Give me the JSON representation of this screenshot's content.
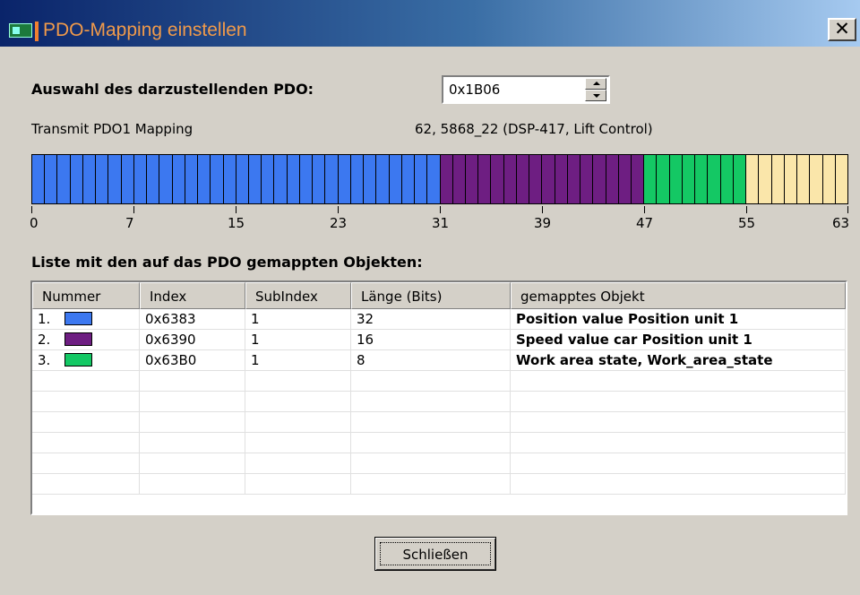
{
  "window": {
    "title": "PDO-Mapping einstellen",
    "close_glyph": "✕"
  },
  "selector": {
    "label": "Auswahl des darzustellenden PDO:",
    "value": "0x1B06"
  },
  "pdo_info": {
    "left": "Transmit PDO1 Mapping",
    "right": "62, 5868_22 (DSP-417, Lift Control)"
  },
  "bitbar": {
    "total_bits": 64,
    "segments": [
      {
        "color": "#3c78f0",
        "bits": 32
      },
      {
        "color": "#6e1e82",
        "bits": 16
      },
      {
        "color": "#14c864",
        "bits": 8
      },
      {
        "color": "#fae6aa",
        "bits": 8
      }
    ],
    "ticks": [
      "0",
      "7",
      "15",
      "23",
      "31",
      "39",
      "47",
      "55",
      "63"
    ]
  },
  "list": {
    "heading": "Liste mit den auf das PDO gemappten Objekten:",
    "columns": [
      "Nummer",
      "Index",
      "SubIndex",
      "Länge (Bits)",
      "gemapptes Objekt"
    ],
    "rows": [
      {
        "nummer": "1.",
        "color": "#3c78f0",
        "index": "0x6383",
        "subindex": "1",
        "laenge": "32",
        "objekt": "Position value Position unit 1"
      },
      {
        "nummer": "2.",
        "color": "#6e1e82",
        "index": "0x6390",
        "subindex": "1",
        "laenge": "16",
        "objekt": "Speed value car Position unit 1"
      },
      {
        "nummer": "3.",
        "color": "#14c864",
        "index": "0x63B0",
        "subindex": "1",
        "laenge": "8",
        "objekt": "Work area state, Work_area_state"
      }
    ],
    "empty_rows": 6
  },
  "buttons": {
    "close_label": "Schließen"
  }
}
